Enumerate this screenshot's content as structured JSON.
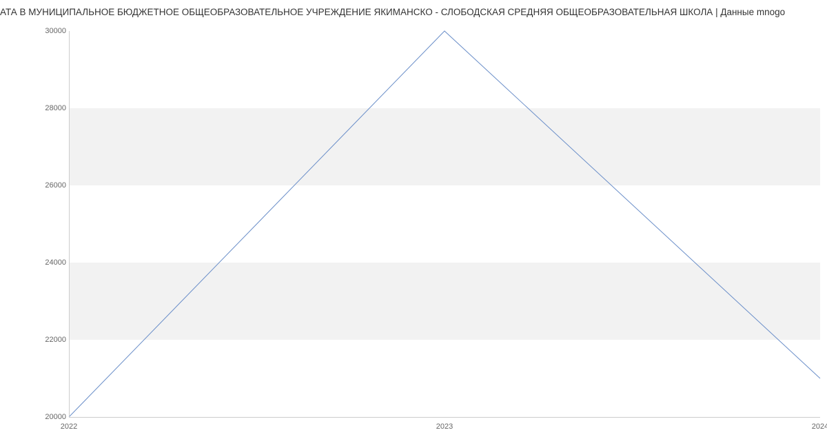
{
  "chart_data": {
    "type": "line",
    "title": "АТА В МУНИЦИПАЛЬНОЕ БЮДЖЕТНОЕ ОБЩЕОБРАЗОВАТЕЛЬНОЕ  УЧРЕЖДЕНИЕ ЯКИМАНСКО - СЛОБОДСКАЯ СРЕДНЯЯ ОБЩЕОБРАЗОВАТЕЛЬНАЯ ШКОЛА | Данные mnogo",
    "x": [
      2022,
      2023,
      2024
    ],
    "values": [
      20000,
      30000,
      21000
    ],
    "xlabel": "",
    "ylabel": "",
    "ylim": [
      20000,
      30000
    ],
    "y_ticks": [
      20000,
      22000,
      24000,
      26000,
      28000,
      30000
    ],
    "x_ticks": [
      2022,
      2023,
      2024
    ],
    "line_color": "#6b8fc9"
  }
}
